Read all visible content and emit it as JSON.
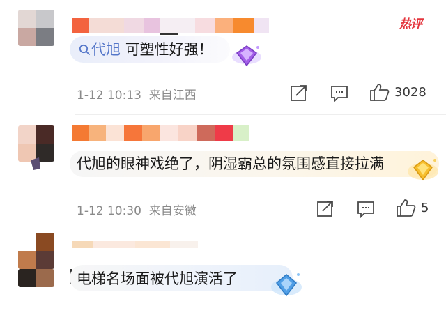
{
  "hot_label": "热评",
  "comments": [
    {
      "mention": "代旭",
      "text": "可塑性好强！",
      "time": "1-12 10:13",
      "location": "来自江西",
      "likes": "3028"
    },
    {
      "text": "代旭的眼神戏绝了，阴湿霸总的氛围感直接拉满",
      "time": "1-12 10:30",
      "location": "来自安徽",
      "likes": "5"
    },
    {
      "text": "电梯名场面被代旭演活了"
    }
  ],
  "icons": {
    "share": "share-icon",
    "comment": "comment-icon",
    "like": "thumbs-up-icon",
    "search": "search-icon"
  },
  "colors": {
    "link": "#5577c9",
    "hot": "#e4353d",
    "meta": "#8a8a8a"
  }
}
